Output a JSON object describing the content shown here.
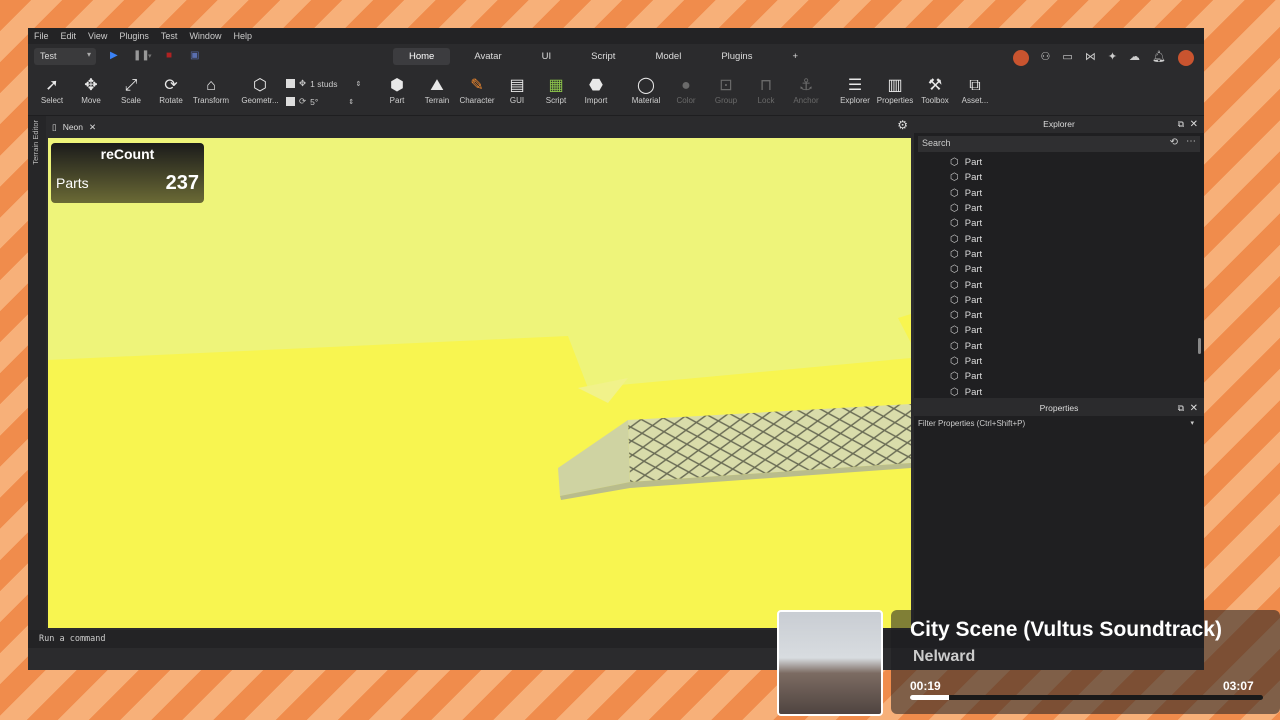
{
  "menu": [
    "File",
    "Edit",
    "View",
    "Plugins",
    "Test",
    "Window",
    "Help"
  ],
  "mode_select": "Test",
  "ribbon_tabs": [
    "Home",
    "Avatar",
    "UI",
    "Script",
    "Model",
    "Plugins",
    "+"
  ],
  "active_tab": "Home",
  "tools": {
    "select": "Select",
    "move": "Move",
    "scale": "Scale",
    "rotate": "Rotate",
    "transform": "Transform",
    "geometry": "Geometr...",
    "part": "Part",
    "terrain": "Terrain",
    "character": "Character",
    "gui": "GUI",
    "script": "Script",
    "import": "Import",
    "material": "Material",
    "color": "Color",
    "group": "Group",
    "lock": "Lock",
    "anchor": "Anchor",
    "explorer": "Explorer",
    "properties": "Properties",
    "toolbox": "Toolbox",
    "asset": "Asset..."
  },
  "snap": {
    "move": "1 studs",
    "rotate": "5°"
  },
  "side_tab": "Terrain Editor",
  "doc_tab": "Neon",
  "recount": {
    "title": "reCount",
    "label": "Parts",
    "value": "237"
  },
  "explorer": {
    "title": "Explorer",
    "search_placeholder": "Search",
    "items": [
      "Part",
      "Part",
      "Part",
      "Part",
      "Part",
      "Part",
      "Part",
      "Part",
      "Part",
      "Part",
      "Part",
      "Part",
      "Part",
      "Part",
      "Part",
      "Part"
    ]
  },
  "properties": {
    "title": "Properties",
    "filter_placeholder": "Filter Properties (Ctrl+Shift+P)"
  },
  "command_bar": "Run a command",
  "music": {
    "title": "City Scene (Vultus Soundtrack)",
    "artist": "Nelward",
    "current": "00:19",
    "total": "03:07",
    "progress": 0.11
  },
  "colors": {
    "accent": "#f28a2e",
    "viewport": "#eef47a"
  }
}
